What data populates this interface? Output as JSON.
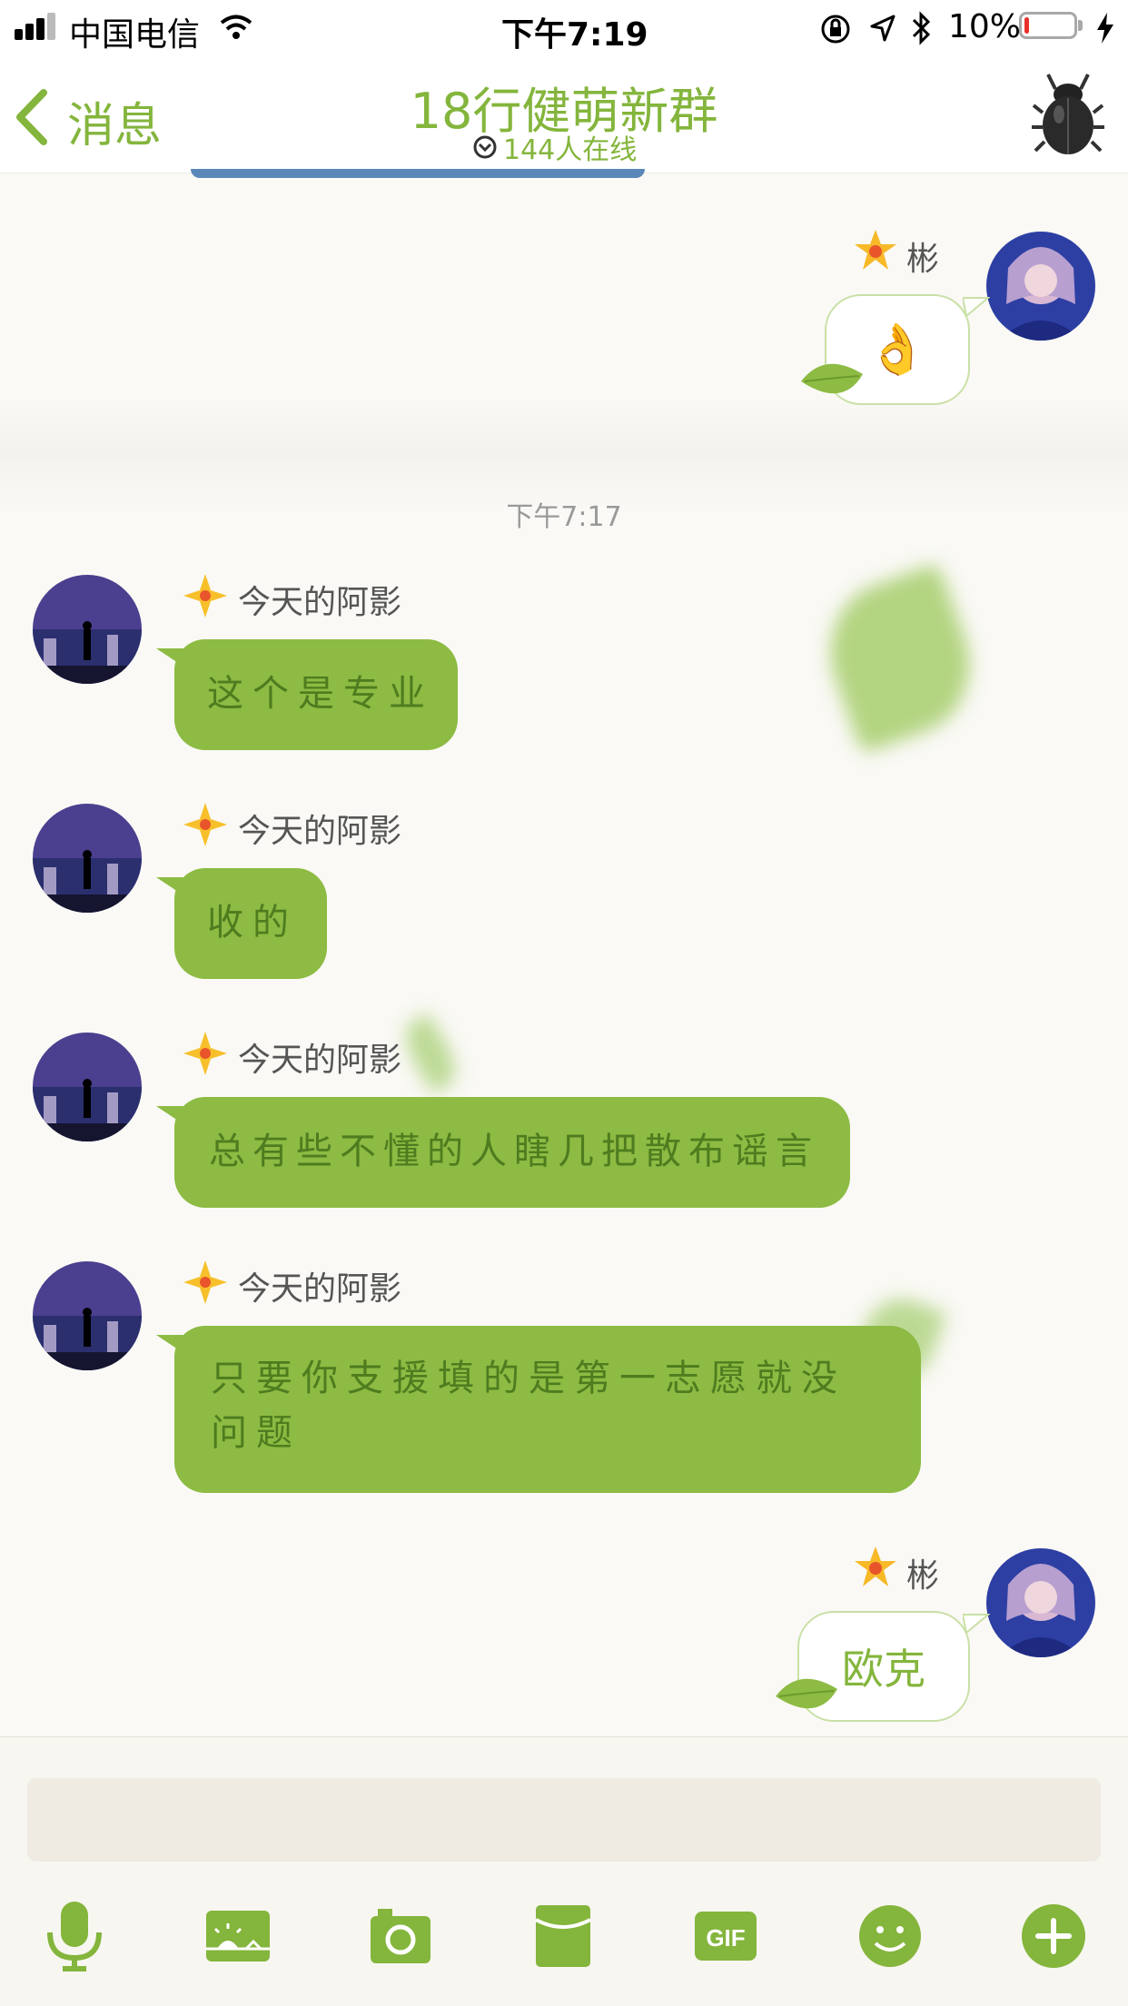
{
  "status_bar": {
    "carrier": "中国电信",
    "time": "下午7:19",
    "battery": "10%",
    "battery_level": 0.1
  },
  "nav": {
    "back_label": "消息",
    "title": "18行健萌新群",
    "online": "144人在线",
    "right_icon": "beetle-icon"
  },
  "chat": {
    "timestamp": "下午7:17",
    "messages": [
      {
        "sender": "彬",
        "side": "right",
        "content": "👌"
      },
      {
        "sender": "今天的阿影",
        "side": "left",
        "content": "这个是专业"
      },
      {
        "sender": "今天的阿影",
        "side": "left",
        "content": "收的"
      },
      {
        "sender": "今天的阿影",
        "side": "left",
        "content": "总有些不懂的人瞎几把散布谣言"
      },
      {
        "sender": "今天的阿影",
        "side": "left",
        "content": "只要你支援填的是第一志愿就没问题"
      },
      {
        "sender": "彬",
        "side": "right",
        "content": "欧克"
      }
    ]
  },
  "toolbar": {
    "items": [
      "mic-icon",
      "photo-icon",
      "camera-icon",
      "red-packet-icon",
      "GIF",
      "emoji-icon",
      "plus-icon"
    ]
  },
  "colors": {
    "accent": "#84b53c",
    "bubble": "#8dbb43",
    "bubble_text": "#4e7c1f"
  }
}
